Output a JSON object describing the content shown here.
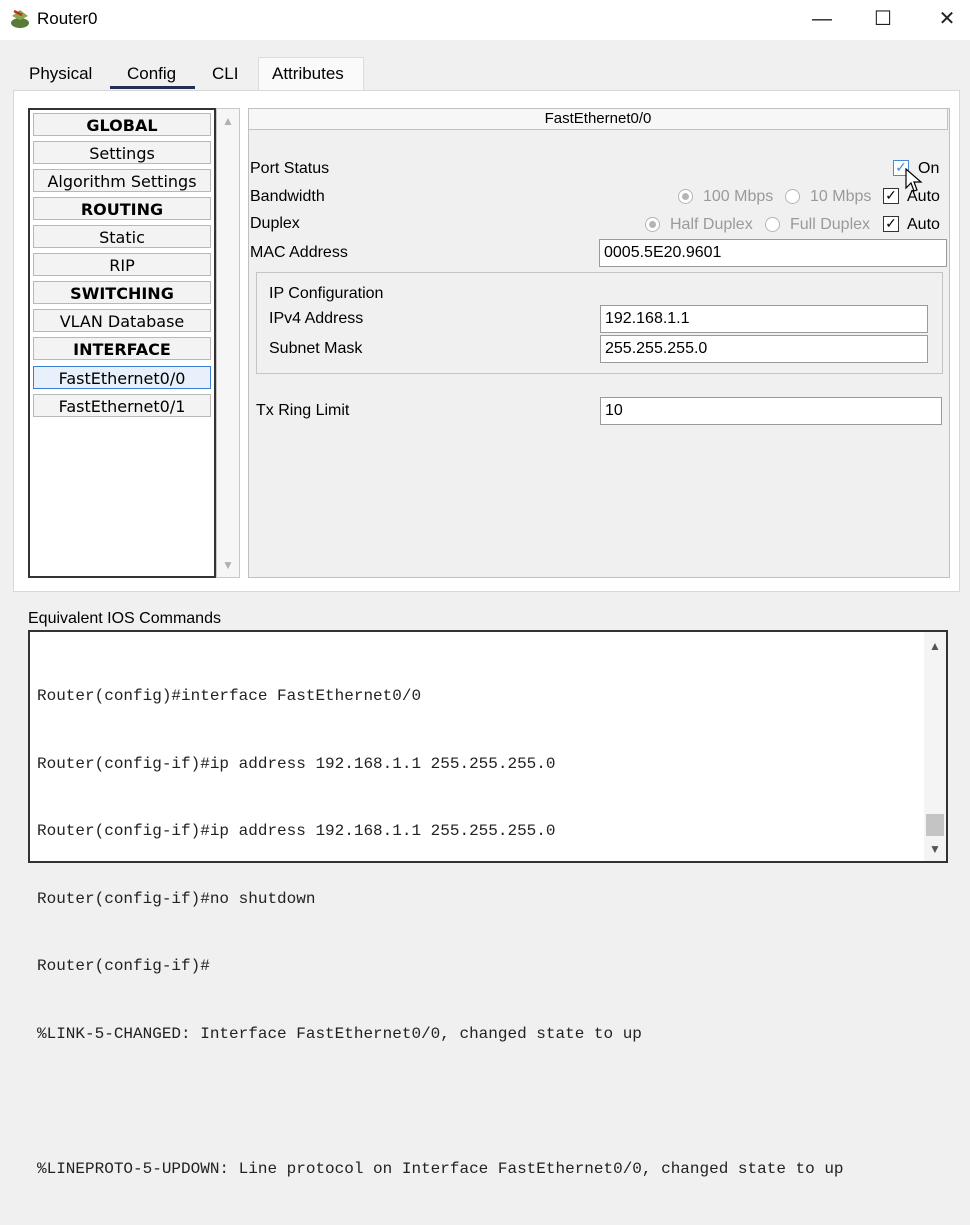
{
  "window": {
    "title": "Router0",
    "minimize_glyph": "—",
    "maximize_glyph": "☐",
    "close_glyph": "✕"
  },
  "tabs": [
    {
      "label": "Physical"
    },
    {
      "label": "Config"
    },
    {
      "label": "CLI"
    },
    {
      "label": "Attributes"
    }
  ],
  "active_tab": "Config",
  "sidebar": {
    "items": [
      {
        "label": "GLOBAL"
      },
      {
        "label": "Settings"
      },
      {
        "label": "Algorithm Settings"
      },
      {
        "label": "ROUTING"
      },
      {
        "label": "Static"
      },
      {
        "label": "RIP"
      },
      {
        "label": "SWITCHING"
      },
      {
        "label": "VLAN Database"
      },
      {
        "label": "INTERFACE"
      },
      {
        "label": "FastEthernet0/0"
      },
      {
        "label": "FastEthernet0/1"
      }
    ],
    "selected": "FastEthernet0/0"
  },
  "panel": {
    "title": "FastEthernet0/0",
    "port_status": {
      "label": "Port Status",
      "on_label": "On",
      "checked": true
    },
    "bandwidth": {
      "label": "Bandwidth",
      "opt1": "100 Mbps",
      "opt2": "10 Mbps",
      "auto_label": "Auto",
      "auto_checked": true
    },
    "duplex": {
      "label": "Duplex",
      "opt1": "Half Duplex",
      "opt2": "Full Duplex",
      "auto_label": "Auto",
      "auto_checked": true
    },
    "mac": {
      "label": "MAC Address",
      "value": "0005.5E20.9601"
    },
    "ip_config": {
      "title": "IP Configuration",
      "ipv4": {
        "label": "IPv4 Address",
        "value": "192.168.1.1"
      },
      "mask": {
        "label": "Subnet Mask",
        "value": "255.255.255.0"
      }
    },
    "tx_ring": {
      "label": "Tx Ring Limit",
      "value": "10"
    }
  },
  "ios": {
    "label": "Equivalent IOS Commands",
    "lines": [
      "Router(config)#interface FastEthernet0/0",
      "Router(config-if)#ip address 192.168.1.1 255.255.255.0",
      "Router(config-if)#ip address 192.168.1.1 255.255.255.0",
      "Router(config-if)#no shutdown",
      "Router(config-if)#",
      "%LINK-5-CHANGED: Interface FastEthernet0/0, changed state to up",
      "",
      "%LINEPROTO-5-UPDOWN: Line protocol on Interface FastEthernet0/0, changed state to up"
    ]
  },
  "icons": [
    "router-icon",
    "minimize-icon",
    "maximize-icon",
    "close-icon",
    "scroll-up-icon",
    "scroll-down-icon",
    "checkmark-icon",
    "mouse-cursor-icon"
  ],
  "colors": {
    "tab_underline": "#1f2f55",
    "selected_border": "#3a7fd5",
    "checkbox_blue": "#4a88d8"
  }
}
